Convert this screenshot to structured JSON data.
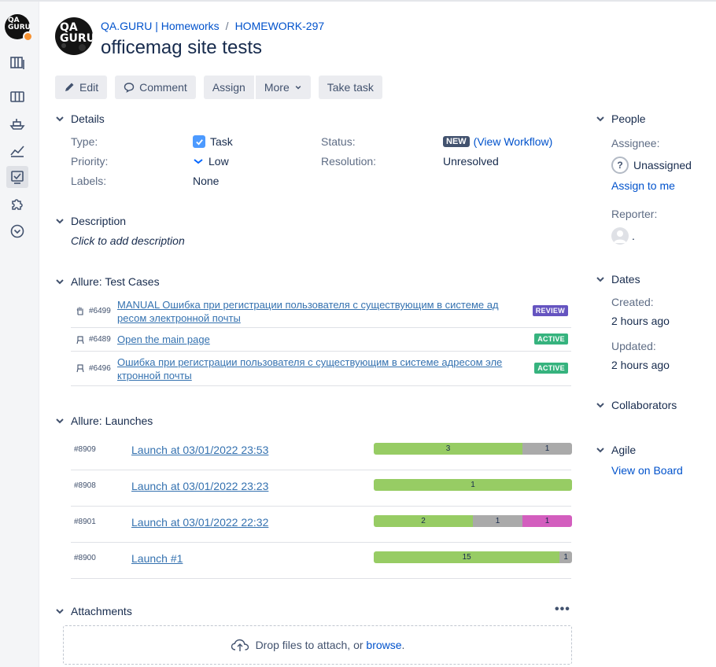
{
  "breadcrumbs": {
    "project": "QA.GURU | Homeworks",
    "issue": "HOMEWORK-297"
  },
  "logo_text": "QA\nGURU",
  "issue_title": "officemag site tests",
  "toolbar": {
    "edit": "Edit",
    "comment": "Comment",
    "assign": "Assign",
    "more": "More",
    "take_task": "Take task"
  },
  "details": {
    "heading": "Details",
    "type_label": "Type:",
    "type_value": "Task",
    "priority_label": "Priority:",
    "priority_value": "Low",
    "labels_label": "Labels:",
    "labels_value": "None",
    "status_label": "Status:",
    "status_value": "NEW",
    "workflow_open": "(",
    "workflow_link": "View Workflow",
    "workflow_close": ")",
    "resolution_label": "Resolution:",
    "resolution_value": "Unresolved"
  },
  "description": {
    "heading": "Description",
    "placeholder": "Click to add description"
  },
  "test_cases": {
    "heading": "Allure: Test Cases",
    "items": [
      {
        "id": "#6499",
        "icon": "hand-icon",
        "name_line1": "MANUAL Ошибка при регистрации пользователя с существующим в системе ад",
        "name_line2": "ресом электронной почты",
        "status": "REVIEW",
        "status_color": "#6554c0"
      },
      {
        "id": "#6489",
        "icon": "robot-icon",
        "name_line1": "Open the main page",
        "name_line2": "",
        "status": "ACTIVE",
        "status_color": "#36b37e"
      },
      {
        "id": "#6496",
        "icon": "robot-icon",
        "name_line1": "Ошибка при регистрации пользователя с существующим в системе адресом эле",
        "name_line2": "ктронной почты",
        "status": "ACTIVE",
        "status_color": "#36b37e"
      }
    ]
  },
  "launches": {
    "heading": "Allure: Launches",
    "items": [
      {
        "id": "#8909",
        "name": "Launch at 03/01/2022 23:53",
        "segments": [
          {
            "value": 3,
            "color": "#97cc64"
          },
          {
            "value": 1,
            "color": "#aaaaaa"
          }
        ]
      },
      {
        "id": "#8908",
        "name": "Launch at 03/01/2022 23:23",
        "segments": [
          {
            "value": 1,
            "color": "#97cc64"
          }
        ]
      },
      {
        "id": "#8901",
        "name": "Launch at 03/01/2022 22:32",
        "segments": [
          {
            "value": 2,
            "color": "#97cc64"
          },
          {
            "value": 1,
            "color": "#aaaaaa"
          },
          {
            "value": 1,
            "color": "#d35ebe"
          }
        ]
      },
      {
        "id": "#8900",
        "name": "Launch #1",
        "segments": [
          {
            "value": 15,
            "color": "#97cc64"
          },
          {
            "value": 1,
            "color": "#aaaaaa"
          }
        ]
      }
    ]
  },
  "attachments": {
    "heading": "Attachments",
    "more": "•••",
    "drop_text": "Drop files to attach, or",
    "browse": "browse",
    "period": "."
  },
  "people": {
    "heading": "People",
    "assignee_label": "Assignee:",
    "assignee_value": "Unassigned",
    "assign_to_me": "Assign to me",
    "reporter_label": "Reporter:",
    "reporter_value": "."
  },
  "dates": {
    "heading": "Dates",
    "created_label": "Created:",
    "created_value": "2 hours ago",
    "updated_label": "Updated:",
    "updated_value": "2 hours ago"
  },
  "collaborators": {
    "heading": "Collaborators"
  },
  "agile": {
    "heading": "Agile",
    "view_on_board": "View on Board"
  }
}
